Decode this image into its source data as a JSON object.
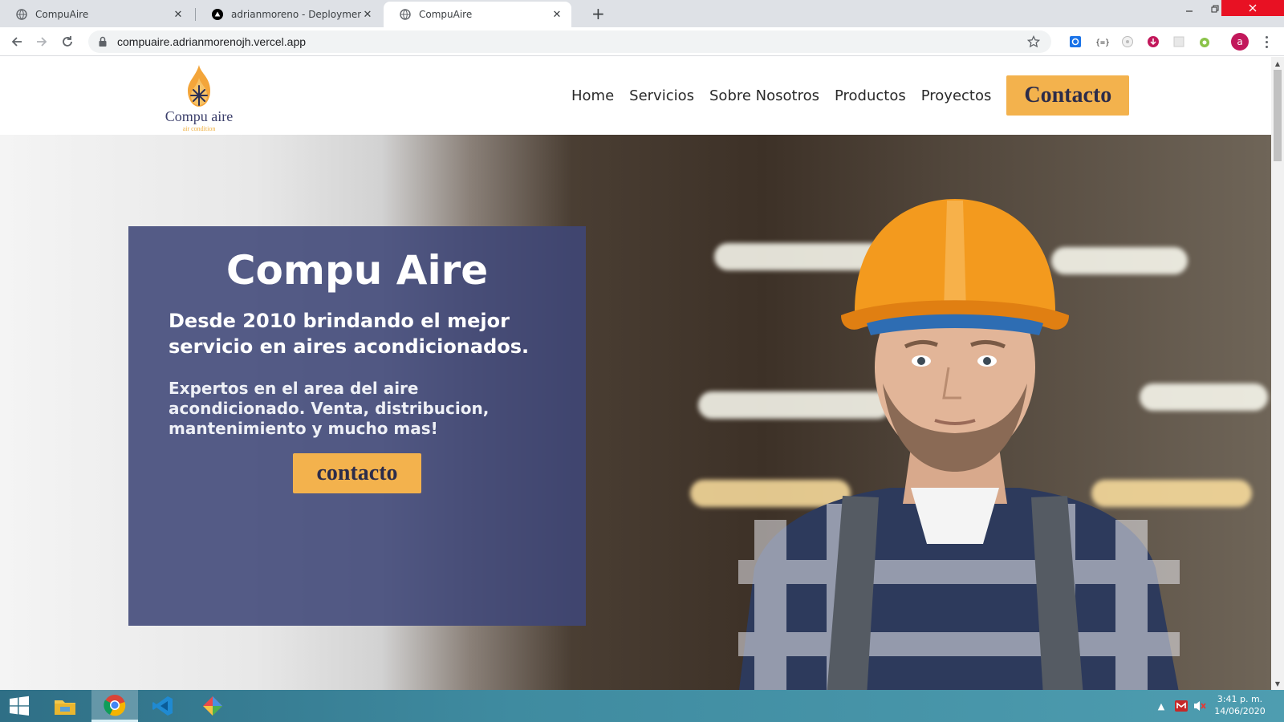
{
  "browser": {
    "tabs": [
      {
        "title": "CompuAire",
        "icon": "globe-icon",
        "active": false
      },
      {
        "title": "adrianmoreno - Deployment Ove",
        "icon": "vercel-icon",
        "active": false
      },
      {
        "title": "CompuAire",
        "icon": "globe-icon",
        "active": true
      }
    ],
    "close_glyph": "✕",
    "new_tab_glyph": "+",
    "url": "compuaire.adrianmorenojh.vercel.app",
    "profile_initial": "a"
  },
  "site": {
    "logo": {
      "name": "Compu aire",
      "tagline": "air condition"
    },
    "nav": [
      "Home",
      "Servicios",
      "Sobre Nosotros",
      "Productos",
      "Proyectos"
    ],
    "nav_cta": "Contacto",
    "hero": {
      "title": "Compu Aire",
      "subtitle": "Desde 2010 brindando el mejor servicio en aires acondicionados.",
      "description": "Expertos en el area del aire acondicionado. Venta, distribucion, mantenimiento y mucho mas!",
      "button": "contacto"
    }
  },
  "taskbar": {
    "apps": [
      "file-explorer-icon",
      "chrome-icon",
      "vscode-icon",
      "app-icon"
    ],
    "time": "3:41 p. m.",
    "date": "14/06/2020"
  },
  "colors": {
    "accent": "#f3b24d",
    "card": "#3f4778",
    "brand_text": "#3b3f6b"
  }
}
